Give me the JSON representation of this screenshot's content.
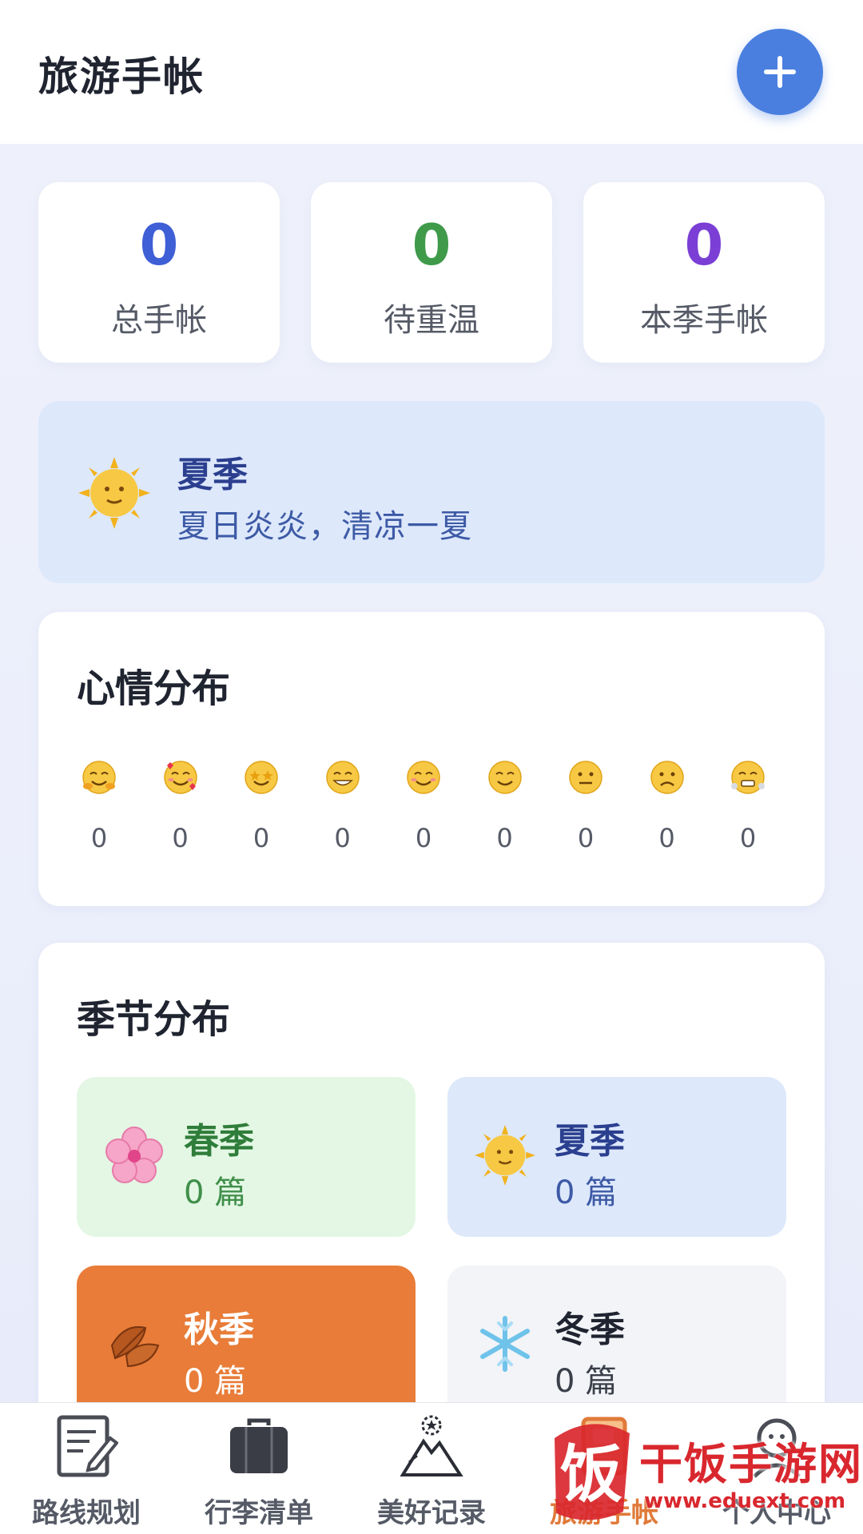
{
  "header": {
    "title": "旅游手帐",
    "add_icon": "plus-icon",
    "accent": "#4a7fe0"
  },
  "stats": [
    {
      "value": "0",
      "label": "总手帐",
      "color": "#3f5fd6"
    },
    {
      "value": "0",
      "label": "待重温",
      "color": "#3f9a4a"
    },
    {
      "value": "0",
      "label": "本季手帐",
      "color": "#7b3fd6"
    }
  ],
  "current_season": {
    "icon": "sun-face-icon",
    "title": "夏季",
    "subtitle": "夏日炎炎，清凉一夏"
  },
  "mood": {
    "title": "心情分布",
    "items": [
      {
        "icon": "hugging-face-icon",
        "count": "0"
      },
      {
        "icon": "smiling-face-with-hearts-icon",
        "count": "0"
      },
      {
        "icon": "star-struck-face-icon",
        "count": "0"
      },
      {
        "icon": "grinning-face-icon",
        "count": "0"
      },
      {
        "icon": "blushing-face-icon",
        "count": "0"
      },
      {
        "icon": "slightly-smiling-face-icon",
        "count": "0"
      },
      {
        "icon": "neutral-face-icon",
        "count": "0"
      },
      {
        "icon": "disappointed-face-icon",
        "count": "0"
      },
      {
        "icon": "huffing-face-icon",
        "count": "0"
      }
    ]
  },
  "seasons": {
    "title": "季节分布",
    "items": [
      {
        "icon": "cherry-blossom-icon",
        "name": "春季",
        "count": "0 篇",
        "bg": "#e3f7e4",
        "name_color": "#2f7d3a",
        "count_color": "#3f8f4a"
      },
      {
        "icon": "sun-face-icon",
        "name": "夏季",
        "count": "0 篇",
        "bg": "#dde8fb",
        "name_color": "#2b3f8f",
        "count_color": "#3d5aa6"
      },
      {
        "icon": "fallen-leaf-icon",
        "name": "秋季",
        "count": "0 篇",
        "bg": "#e87c38",
        "name_color": "#ffffff",
        "count_color": "#ffffff"
      },
      {
        "icon": "snowflake-icon",
        "name": "冬季",
        "count": "0 篇",
        "bg": "#f2f4f7",
        "name_color": "#1f2430",
        "count_color": "#3a3f4a"
      }
    ]
  },
  "tabbar": {
    "items": [
      {
        "label": "路线规划",
        "icon": "notepad-pen-icon"
      },
      {
        "label": "行李清单",
        "icon": "suitcase-icon"
      },
      {
        "label": "美好记录",
        "icon": "mountain-star-icon"
      },
      {
        "label": "旅游手帐",
        "icon": "journal-icon",
        "active": true
      },
      {
        "label": "个人中心",
        "icon": "user-icon"
      }
    ]
  },
  "watermark": {
    "text": "干饭手游网",
    "url": "www.eduext.com",
    "logo_char": "饭"
  }
}
